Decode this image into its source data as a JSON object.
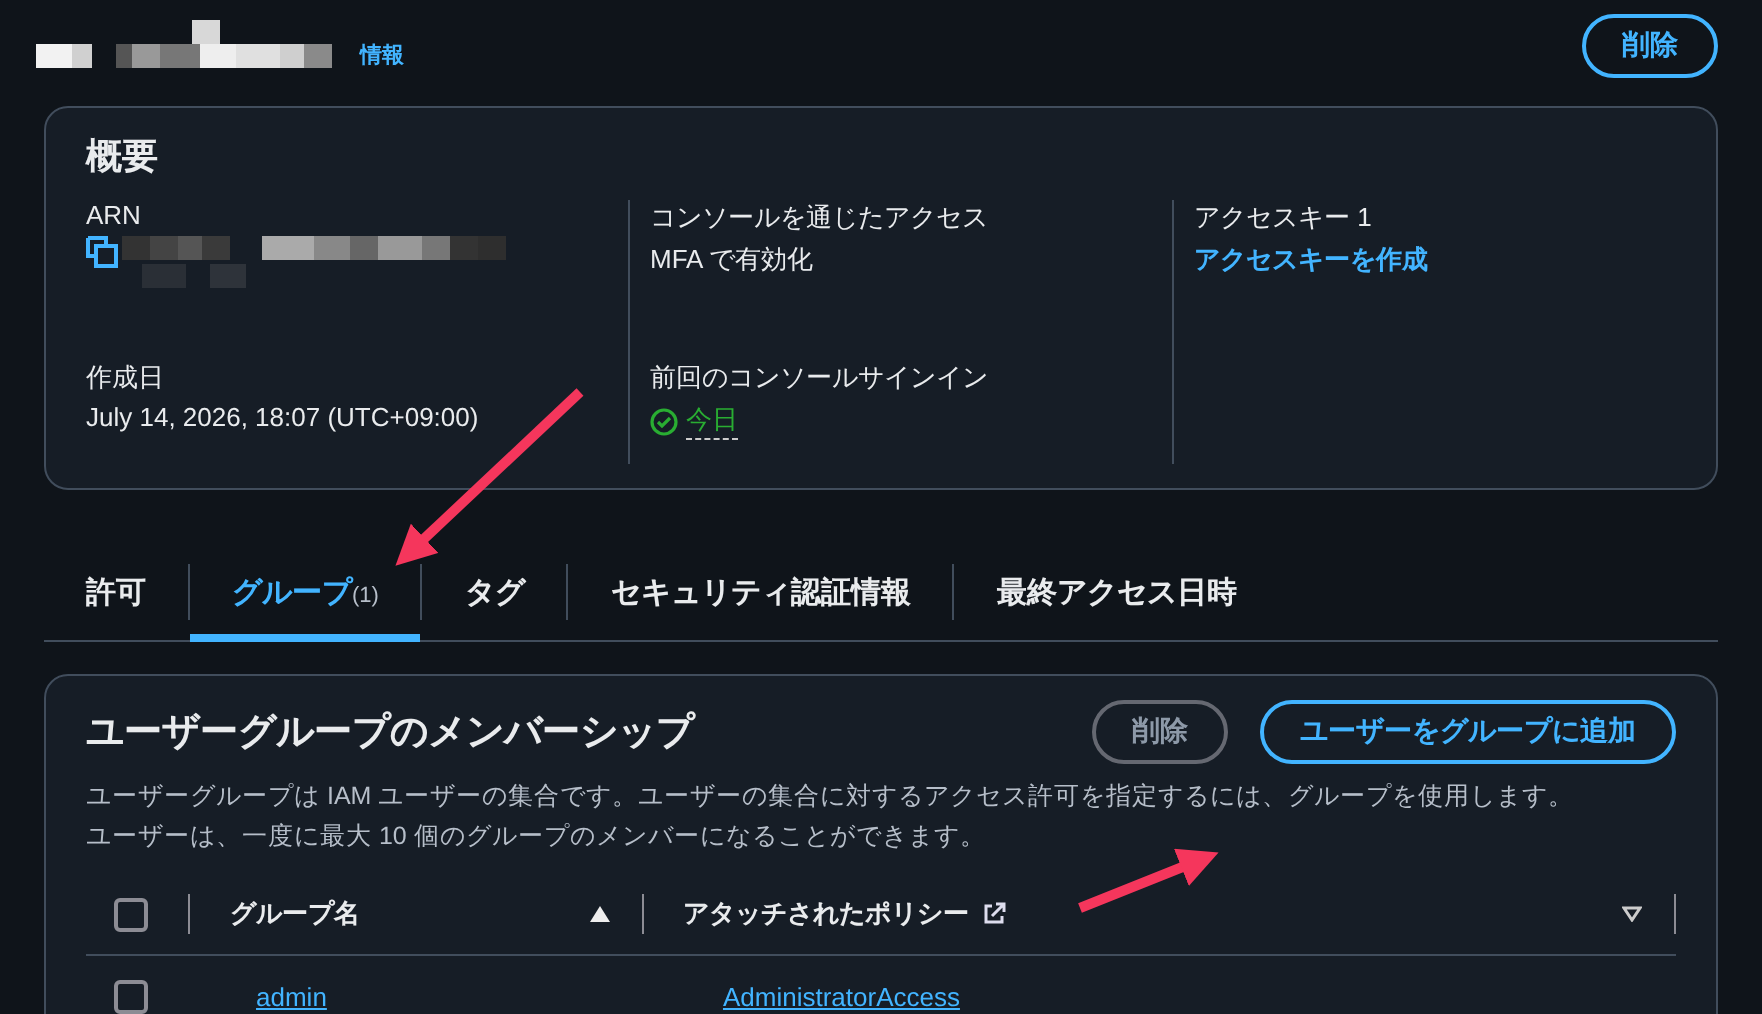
{
  "header": {
    "info_link": "情報",
    "delete_button": "削除"
  },
  "summary": {
    "title": "概要",
    "fields": [
      {
        "label": "ARN",
        "kind": "redacted"
      },
      {
        "label": "コンソールを通じたアクセス",
        "kind": "text",
        "value": "MFA で有効化"
      },
      {
        "label": "アクセスキー 1",
        "kind": "link",
        "value": "アクセスキーを作成"
      },
      {
        "label": "作成日",
        "kind": "text",
        "value": "July 14, 2026, 18:07 (UTC+09:00)"
      },
      {
        "label": "前回のコンソールサインイン",
        "kind": "status",
        "value": "今日"
      }
    ]
  },
  "tabs": [
    {
      "label": "許可",
      "selected": false
    },
    {
      "label": "グループ",
      "count": "(1)",
      "selected": true
    },
    {
      "label": "タグ",
      "selected": false
    },
    {
      "label": "セキュリティ認証情報",
      "selected": false
    },
    {
      "label": "最終アクセス日時",
      "selected": false
    }
  ],
  "groups": {
    "title": "ユーザーグループのメンバーシップ",
    "buttons": [
      {
        "label": "削除",
        "disabled": true
      },
      {
        "label": "ユーザーをグループに追加",
        "disabled": false
      }
    ],
    "description": "ユーザーグループは IAM ユーザーの集合です。ユーザーの集合に対するアクセス許可を指定するには、グループを使用します。ユーザーは、一度に最大 10 個のグループのメンバーになることができます。",
    "table": {
      "select_all_checked": false,
      "columns": [
        {
          "label": "グループ名",
          "sorted": true
        },
        {
          "label": "アタッチされたポリシー",
          "sorted": false,
          "external": true
        }
      ],
      "rows": [
        {
          "checked": false,
          "cells": [
            "admin",
            "AdministratorAccess"
          ]
        }
      ]
    }
  }
}
